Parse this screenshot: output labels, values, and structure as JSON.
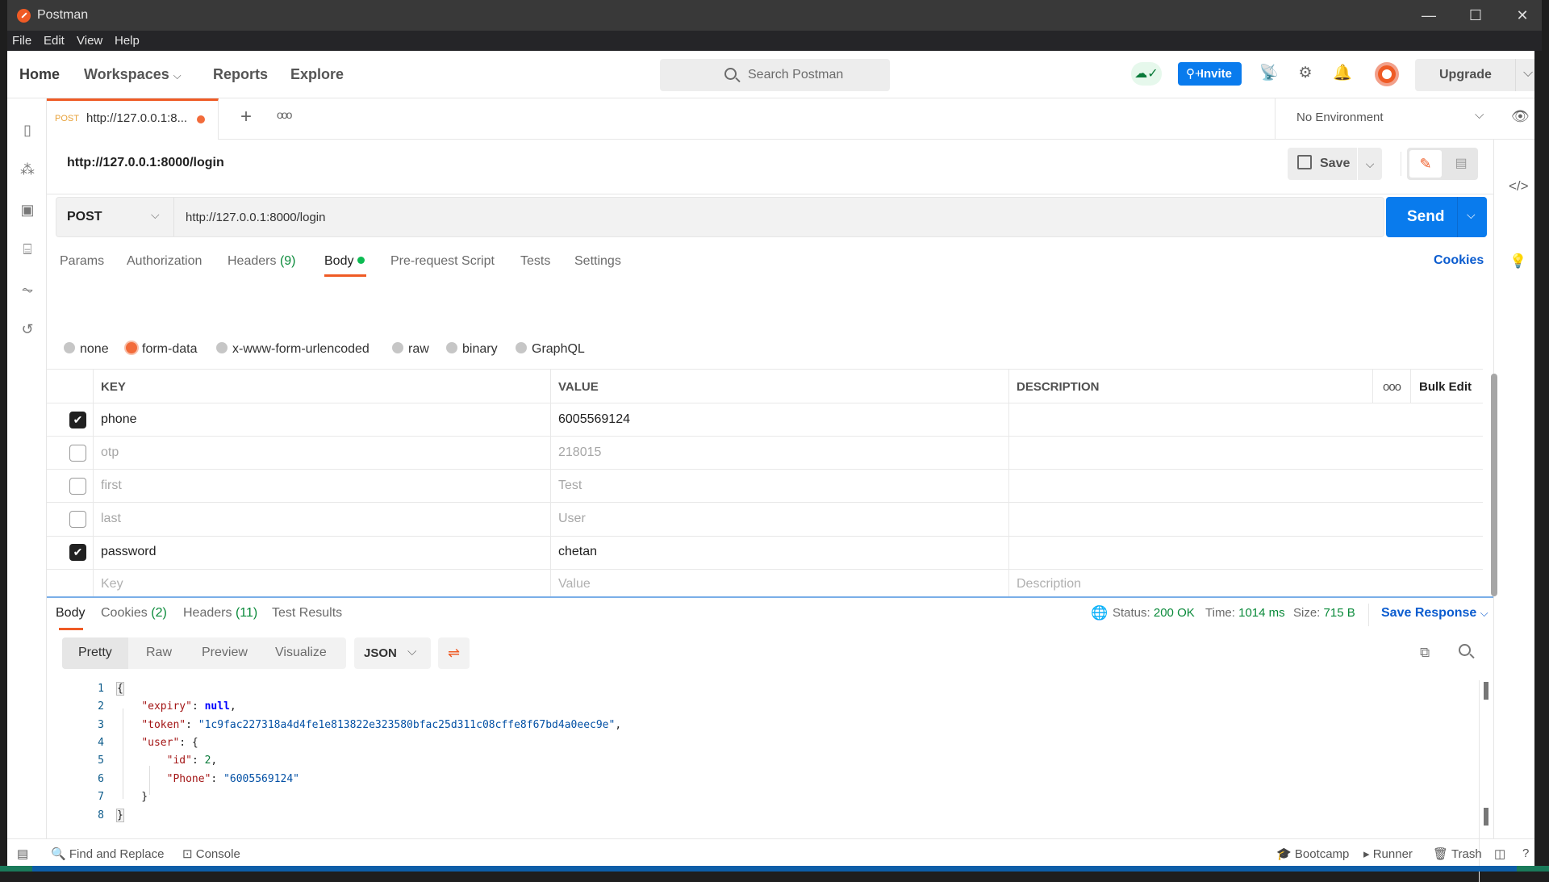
{
  "window": {
    "title": "Postman",
    "controls": {
      "minimize": "—",
      "maximize": "☐",
      "close": "✕"
    }
  },
  "menu": [
    "File",
    "Edit",
    "View",
    "Help"
  ],
  "header": {
    "nav": [
      "Home",
      "Workspaces",
      "Reports",
      "Explore"
    ],
    "search_placeholder": "Search Postman",
    "invite_label": "Invite",
    "upgrade_label": "Upgrade",
    "icons": [
      "cloud-sync-icon",
      "satellite-icon",
      "settings-icon",
      "bell-icon",
      "avatar"
    ]
  },
  "tabs": {
    "open": [
      {
        "method": "POST",
        "label": "http://127.0.0.1:8...",
        "unsaved": true
      }
    ],
    "environment": "No Environment"
  },
  "request": {
    "title": "http://127.0.0.1:8000/login",
    "save_label": "Save",
    "method": "POST",
    "url": "http://127.0.0.1:8000/login",
    "send_label": "Send",
    "tabs": [
      {
        "label": "Params"
      },
      {
        "label": "Authorization"
      },
      {
        "label": "Headers",
        "count": "(9)"
      },
      {
        "label": "Body",
        "active": true
      },
      {
        "label": "Pre-request Script"
      },
      {
        "label": "Tests"
      },
      {
        "label": "Settings"
      }
    ],
    "cookies_label": "Cookies",
    "body_types": [
      {
        "label": "none",
        "selected": false
      },
      {
        "label": "form-data",
        "selected": true
      },
      {
        "label": "x-www-form-urlencoded",
        "selected": false
      },
      {
        "label": "raw",
        "selected": false
      },
      {
        "label": "binary",
        "selected": false
      },
      {
        "label": "GraphQL",
        "selected": false
      }
    ],
    "table": {
      "headers": {
        "key": "KEY",
        "value": "VALUE",
        "description": "DESCRIPTION",
        "bulk_edit": "Bulk Edit"
      },
      "rows": [
        {
          "enabled": true,
          "key": "phone",
          "value": "6005569124",
          "description": ""
        },
        {
          "enabled": false,
          "key": "otp",
          "value": "218015",
          "description": ""
        },
        {
          "enabled": false,
          "key": "first",
          "value": "Test",
          "description": ""
        },
        {
          "enabled": false,
          "key": "last",
          "value": "User",
          "description": ""
        },
        {
          "enabled": true,
          "key": "password",
          "value": "chetan",
          "description": ""
        }
      ],
      "placeholders": {
        "key": "Key",
        "value": "Value",
        "description": "Description"
      }
    }
  },
  "response": {
    "tabs": [
      {
        "label": "Body",
        "active": true
      },
      {
        "label": "Cookies",
        "count": "(2)"
      },
      {
        "label": "Headers",
        "count": "(11)"
      },
      {
        "label": "Test Results"
      }
    ],
    "status_label": "Status:",
    "status": "200 OK",
    "time_label": "Time:",
    "time": "1014 ms",
    "size_label": "Size:",
    "size": "715 B",
    "save_response_label": "Save Response",
    "views": [
      "Pretty",
      "Raw",
      "Preview",
      "Visualize"
    ],
    "format": "JSON",
    "lines": [
      "1",
      "2",
      "3",
      "4",
      "5",
      "6",
      "7",
      "8"
    ],
    "json": {
      "expiry_key": "\"expiry\"",
      "expiry_val": "null",
      "token_key": "\"token\"",
      "token_val": "\"1c9fac227318a4d4fe1e813822e323580bfac25d311c08cffe8f67bd4a0eec9e\"",
      "user_key": "\"user\"",
      "id_key": "\"id\"",
      "id_val": "2",
      "phone_key": "\"Phone\"",
      "phone_val": "\"6005569124\""
    }
  },
  "statusbar": {
    "find_replace": "Find and Replace",
    "console": "Console",
    "bootcamp": "Bootcamp",
    "runner": "Runner",
    "trash": "Trash"
  }
}
